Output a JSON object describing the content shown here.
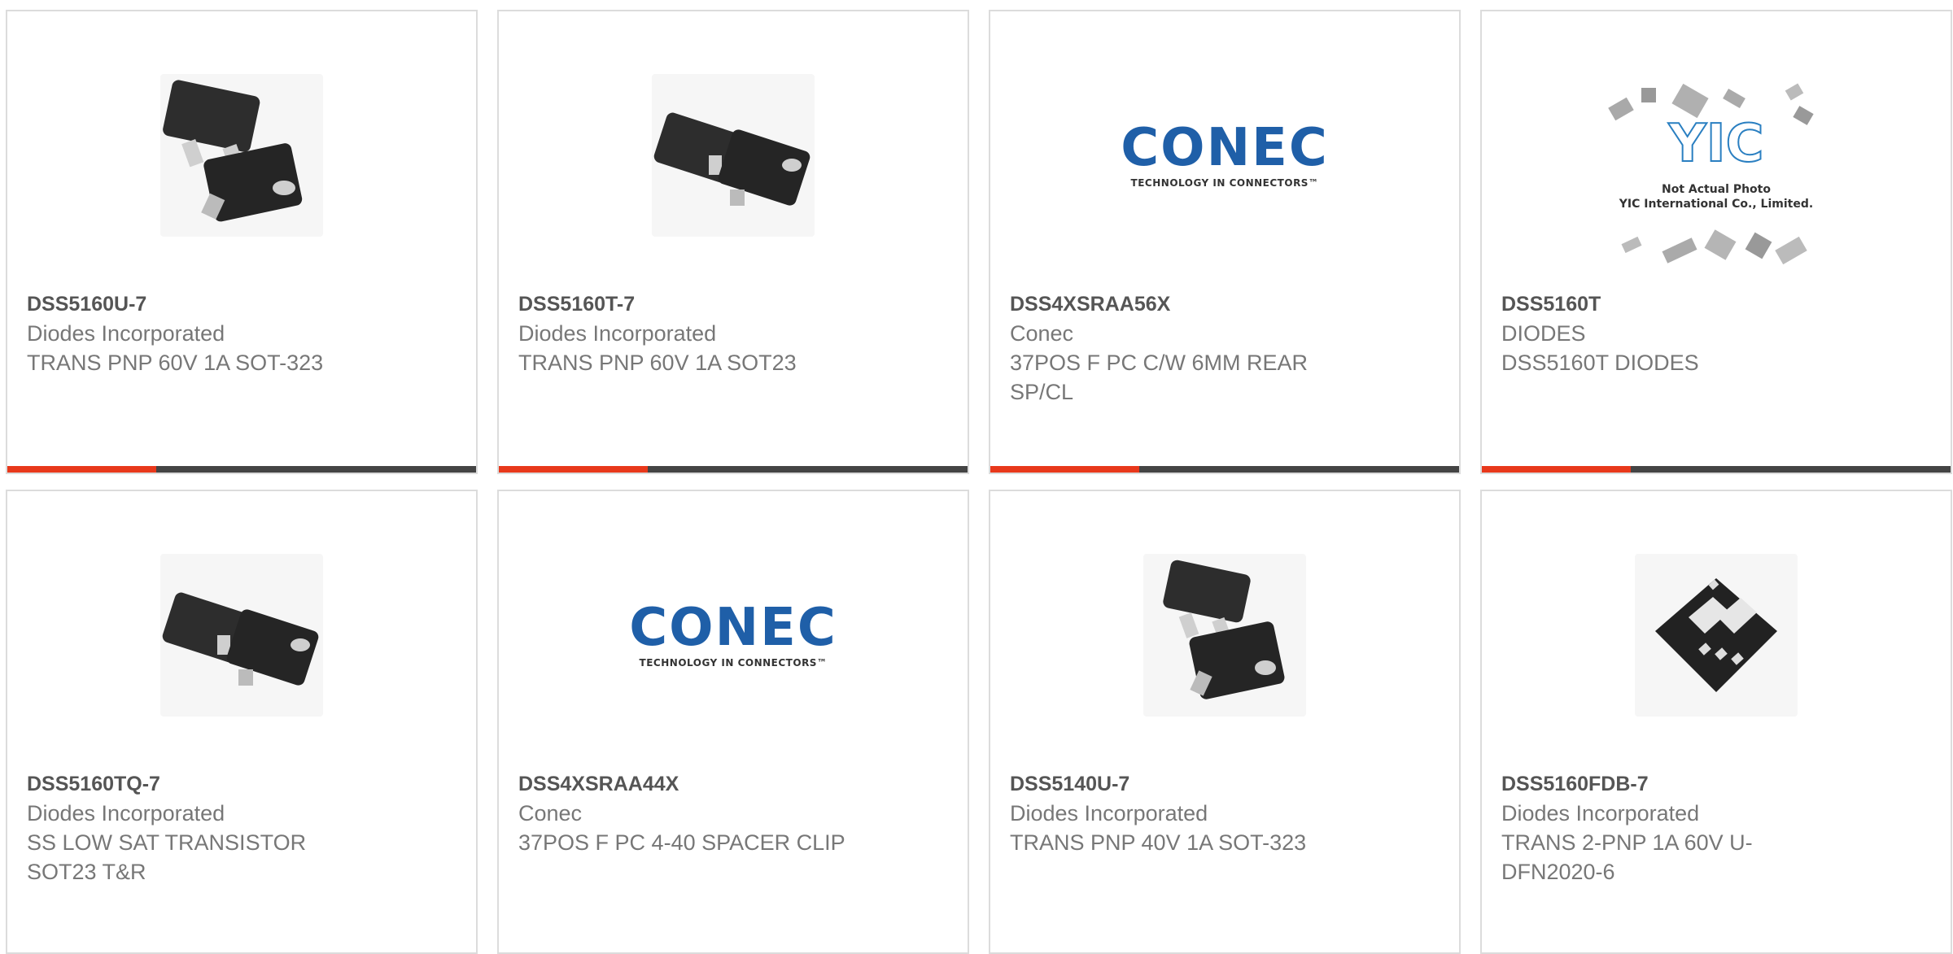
{
  "cards": [
    {
      "part": "DSS5160U-7",
      "manufacturer": "Diodes Incorporated",
      "description": "TRANS PNP 60V 1A SOT-323",
      "image": "sot323-transistor-photo"
    },
    {
      "part": "DSS5160T-7",
      "manufacturer": "Diodes Incorporated",
      "description": "TRANS PNP 60V 1A SOT23",
      "image": "sot23-transistor-photo"
    },
    {
      "part": "DSS4XSRAA56X",
      "manufacturer": "Conec",
      "description": "37POS F PC C/W 6MM REAR SP/CL",
      "image": "conec-logo"
    },
    {
      "part": "DSS5160T",
      "manufacturer": "DIODES",
      "description": "DSS5160T DIODES",
      "image": "yic-placeholder"
    },
    {
      "part": "DSS5160TQ-7",
      "manufacturer": "Diodes Incorporated",
      "description": "SS LOW SAT TRANSISTOR SOT23 T&R",
      "image": "sot23-transistor-photo"
    },
    {
      "part": "DSS4XSRAA44X",
      "manufacturer": "Conec",
      "description": "37POS F PC 4-40 SPACER CLIP",
      "image": "conec-logo"
    },
    {
      "part": "DSS5140U-7",
      "manufacturer": "Diodes Incorporated",
      "description": "TRANS PNP 40V 1A SOT-323",
      "image": "sot323-transistor-photo"
    },
    {
      "part": "DSS5160FDB-7",
      "manufacturer": "Diodes Incorporated",
      "description": "TRANS 2-PNP 1A 60V U-DFN2020-6",
      "image": "dfn-package-photo"
    }
  ],
  "logos": {
    "conec_word": "CONEC",
    "conec_tagline": "TECHNOLOGY IN CONNECTORS™",
    "yic_mark": "YIC",
    "yic_line1": "Not Actual Photo",
    "yic_line2": "YIC International Co., Limited."
  },
  "colors": {
    "accent": "#e8381b",
    "bar": "#444444",
    "conec_blue": "#1f5fa8",
    "yic_blue": "#2a7fc1"
  }
}
